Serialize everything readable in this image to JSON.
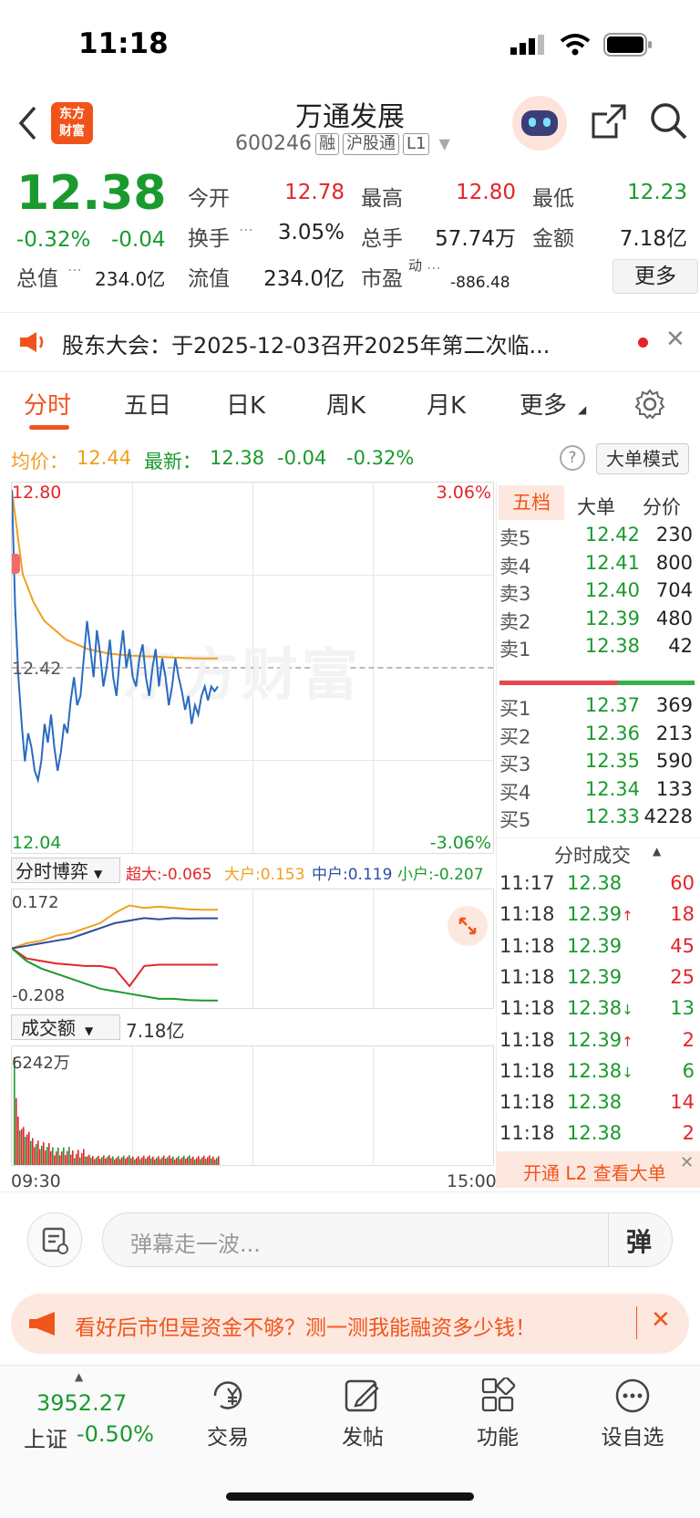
{
  "status_bar": {
    "time": "11:18"
  },
  "header": {
    "title": "万通发展",
    "code": "600246",
    "tags": [
      "融",
      "沪股通",
      "L1"
    ],
    "logo_text": "东方财富"
  },
  "quote": {
    "price": "12.38",
    "change_pct": "-0.32%",
    "change": "-0.04",
    "stats": [
      {
        "label": "今开",
        "value": "12.78"
      },
      {
        "label": "最高",
        "value": "12.80"
      },
      {
        "label": "最低",
        "value": "12.23"
      },
      {
        "label": "换手",
        "value": "3.05%"
      },
      {
        "label": "总手",
        "value": "57.74万"
      },
      {
        "label": "金额",
        "value": "7.18亿"
      },
      {
        "label": "总值",
        "value": "234.0亿"
      },
      {
        "label": "流值",
        "value": "234.0亿"
      },
      {
        "label": "市盈",
        "superscript": "动",
        "value": "-886.48"
      }
    ],
    "more_label": "更多"
  },
  "notice": {
    "text": "股东大会：于2025-12-03召开2025年第二次临..."
  },
  "tabs": [
    "分时",
    "五日",
    "日K",
    "周K",
    "月K",
    "更多"
  ],
  "active_tab": "分时",
  "chart_header": {
    "avg_label": "均价：",
    "avg_value": "12.44",
    "latest_label": "最新：",
    "latest_value": "12.38",
    "latest_change": "-0.04",
    "latest_pct": "-0.32%",
    "mode_button": "大单模式"
  },
  "chart_data": {
    "type": "line",
    "price_axis": {
      "top": "12.80",
      "mid": "12.42",
      "bottom": "12.04"
    },
    "pct_axis": {
      "top": "3.06%",
      "bottom": "-3.06%"
    },
    "ylim": [
      12.04,
      12.8
    ],
    "series": [
      {
        "values": [
          12.8,
          12.55,
          12.4,
          12.3,
          12.22,
          12.28,
          12.25,
          12.2,
          12.18,
          12.22,
          12.3,
          12.26,
          12.32,
          12.25,
          12.2,
          12.24,
          12.3,
          12.28,
          12.35,
          12.4,
          12.34,
          12.36,
          12.44,
          12.52,
          12.46,
          12.4,
          12.5,
          12.45,
          12.38,
          12.42,
          12.48,
          12.4,
          12.36,
          12.44,
          12.5,
          12.42,
          12.46,
          12.4,
          12.38,
          12.44,
          12.47,
          12.4,
          12.36,
          12.42,
          12.46,
          12.38,
          12.44,
          12.4,
          12.34,
          12.38,
          12.44,
          12.4,
          12.37,
          12.33,
          12.36,
          12.3,
          12.34,
          12.32,
          12.36,
          12.38,
          12.35,
          12.38,
          12.37,
          12.38
        ]
      },
      {
        "values": [
          12.8,
          12.62,
          12.56,
          12.52,
          12.5,
          12.48,
          12.47,
          12.46,
          12.455,
          12.45,
          12.448,
          12.446,
          12.445,
          12.444,
          12.443,
          12.442,
          12.441,
          12.44,
          12.44,
          12.44
        ]
      }
    ],
    "time_start": "09:30",
    "time_end": "15:00",
    "game_panel": {
      "dropdown_label": "分时博弈",
      "super": "超大:-0.065",
      "large": "大户:0.153",
      "mid": "中户:0.119",
      "small": "小户:-0.207",
      "y_top": "0.172",
      "y_bottom": "-0.208",
      "series": [
        {
          "values": [
            0.0,
            0.02,
            0.03,
            0.05,
            0.06,
            0.08,
            0.1,
            0.14,
            0.17,
            0.16,
            0.165,
            0.16,
            0.155,
            0.153,
            0.153
          ]
        },
        {
          "values": [
            0.0,
            0.01,
            0.02,
            0.03,
            0.04,
            0.06,
            0.08,
            0.1,
            0.11,
            0.12,
            0.115,
            0.12,
            0.118,
            0.119,
            0.119
          ]
        },
        {
          "values": [
            0.0,
            -0.04,
            -0.05,
            -0.06,
            -0.065,
            -0.07,
            -0.07,
            -0.08,
            -0.15,
            -0.07,
            -0.065,
            -0.065,
            -0.065,
            -0.065,
            -0.065
          ]
        },
        {
          "values": [
            0.0,
            -0.05,
            -0.08,
            -0.1,
            -0.12,
            -0.14,
            -0.16,
            -0.17,
            -0.18,
            -0.19,
            -0.2,
            -0.2,
            -0.205,
            -0.207,
            -0.207
          ]
        }
      ]
    },
    "volume_panel": {
      "dropdown_label": "成交额",
      "total": "7.18亿",
      "max_label": "6242万"
    }
  },
  "order_book": {
    "tabs": [
      "五档",
      "大单",
      "分价"
    ],
    "asks": [
      {
        "label": "卖5",
        "price": "12.42",
        "volume": "230"
      },
      {
        "label": "卖4",
        "price": "12.41",
        "volume": "800"
      },
      {
        "label": "卖3",
        "price": "12.40",
        "volume": "704"
      },
      {
        "label": "卖2",
        "price": "12.39",
        "volume": "480"
      },
      {
        "label": "卖1",
        "price": "12.38",
        "volume": "42"
      }
    ],
    "bids": [
      {
        "label": "买1",
        "price": "12.37",
        "volume": "369"
      },
      {
        "label": "买2",
        "price": "12.36",
        "volume": "213"
      },
      {
        "label": "买3",
        "price": "12.35",
        "volume": "590"
      },
      {
        "label": "买4",
        "price": "12.34",
        "volume": "133"
      },
      {
        "label": "买5",
        "price": "12.33",
        "volume": "4228"
      }
    ]
  },
  "trades": {
    "title": "分时成交",
    "rows": [
      {
        "time": "11:17",
        "price": "12.38",
        "arrow": "",
        "volume": "60",
        "color": "#e3242b"
      },
      {
        "time": "11:18",
        "price": "12.39",
        "arrow": "↑",
        "volume": "18",
        "color": "#e3242b"
      },
      {
        "time": "11:18",
        "price": "12.39",
        "arrow": "",
        "volume": "45",
        "color": "#e3242b"
      },
      {
        "time": "11:18",
        "price": "12.39",
        "arrow": "",
        "volume": "25",
        "color": "#e3242b"
      },
      {
        "time": "11:18",
        "price": "12.38",
        "arrow": "↓",
        "volume": "13",
        "color": "#1a9a2e"
      },
      {
        "time": "11:18",
        "price": "12.39",
        "arrow": "↑",
        "volume": "2",
        "color": "#e3242b"
      },
      {
        "time": "11:18",
        "price": "12.38",
        "arrow": "↓",
        "volume": "6",
        "color": "#1a9a2e"
      },
      {
        "time": "11:18",
        "price": "12.38",
        "arrow": "",
        "volume": "14",
        "color": "#e3242b"
      },
      {
        "time": "11:18",
        "price": "12.38",
        "arrow": "",
        "volume": "2",
        "color": "#e3242b"
      }
    ],
    "l2_promo": "开通 L2 查看大单"
  },
  "comment_bar": {
    "placeholder": "弹幕走一波...",
    "danmaku_button": "弹"
  },
  "ad_banner": {
    "text": "看好后市但是资金不够？测一测我能融资多少钱！"
  },
  "bottom_nav": {
    "index_value": "3952.27",
    "index_name": "上证",
    "index_change": "-0.50%",
    "items": [
      {
        "label": "交易",
        "icon": "yen-cycle-icon"
      },
      {
        "label": "发帖",
        "icon": "edit-icon"
      },
      {
        "label": "功能",
        "icon": "grid-icon"
      },
      {
        "label": "设自选",
        "icon": "more-dots-icon"
      }
    ]
  },
  "colors": {
    "up": "#e3242b",
    "down": "#1a9a2e",
    "avg": "#f0a020",
    "price_line": "#2a6bc0",
    "accent": "#f1541b"
  }
}
